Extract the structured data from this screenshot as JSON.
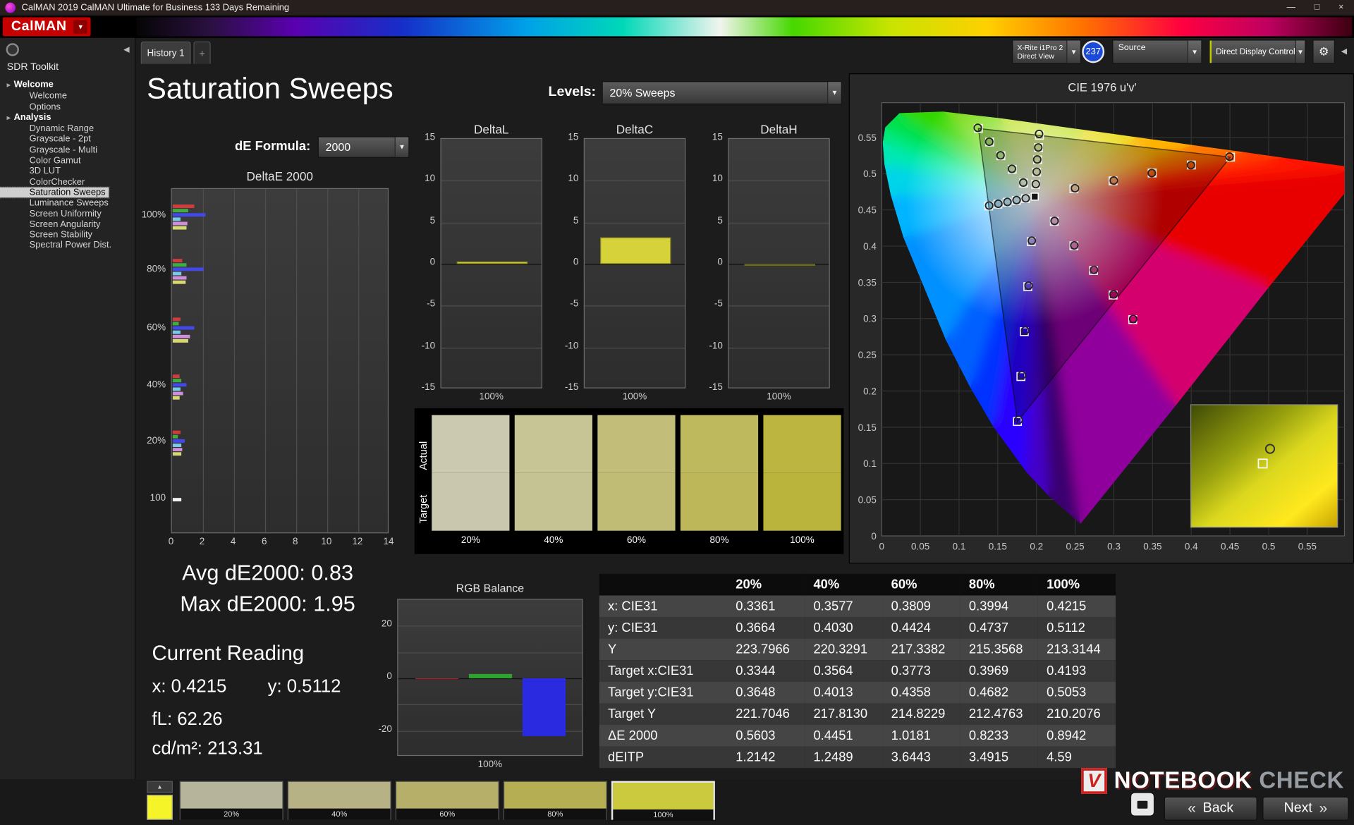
{
  "window": {
    "title": "CalMAN 2019 CalMAN Ultimate for Business 133 Days Remaining",
    "controls": {
      "minimize": "—",
      "maximize": "□",
      "close": "×"
    }
  },
  "icons": {
    "caret_down": "▾",
    "dropdown_arrow": "▼",
    "collapse_left": "◀",
    "up_arrow": "▲",
    "gear": "⚙",
    "tree_expander": "▸",
    "back_chevrons": "«",
    "next_chevrons": "»"
  },
  "logo": {
    "text": "CalMAN"
  },
  "tabs": {
    "history": "History 1",
    "add": "+"
  },
  "toolbar": {
    "meter_line1": "X-Rite i1Pro 2",
    "meter_line2": "Direct View",
    "badge": "237",
    "source": "Source",
    "display_control": "Direct Display Control"
  },
  "sidebar": {
    "title": "SDR Toolkit",
    "selected": "Saturation Sweeps",
    "sections": [
      {
        "label": "Welcome",
        "items": [
          "Welcome",
          "Options"
        ]
      },
      {
        "label": "Analysis",
        "items": [
          "Dynamic Range",
          "Grayscale - 2pt",
          "Grayscale - Multi",
          "Color Gamut",
          "3D LUT",
          "ColorChecker",
          "Saturation Sweeps",
          "Luminance Sweeps",
          "Screen Uniformity",
          "Screen Angularity",
          "Screen Stability",
          "Spectral Power Dist."
        ]
      }
    ]
  },
  "page": {
    "title": "Saturation Sweeps",
    "levels_label": "Levels:",
    "levels_value": "20% Sweeps",
    "de_formula_label": "dE Formula:",
    "de_formula_value": "2000"
  },
  "readings": {
    "avg": "Avg dE2000: 0.83",
    "max": "Max dE2000: 1.95",
    "current_label": "Current Reading",
    "x": "x: 0.4215",
    "y": "y: 0.5112",
    "fl": "fL: 62.26",
    "cdm2": "cd/m²: 213.31"
  },
  "swatch_panel": {
    "actual_label": "Actual",
    "target_label": "Target",
    "levels": [
      {
        "label": "20%",
        "actual": "#cbcab1",
        "target": "#c9c8ae"
      },
      {
        "label": "40%",
        "actual": "#c7c496",
        "target": "#c5c293"
      },
      {
        "label": "60%",
        "actual": "#c2bd79",
        "target": "#c0bc76"
      },
      {
        "label": "80%",
        "actual": "#bfb95e",
        "target": "#bdb75a"
      },
      {
        "label": "100%",
        "actual": "#bcb640",
        "target": "#bab43c"
      }
    ]
  },
  "table": {
    "headers": [
      "20%",
      "40%",
      "60%",
      "80%",
      "100%"
    ],
    "rows": [
      {
        "label": "x: CIE31",
        "values": [
          "0.3361",
          "0.3577",
          "0.3809",
          "0.3994",
          "0.4215"
        ]
      },
      {
        "label": "y: CIE31",
        "values": [
          "0.3664",
          "0.4030",
          "0.4424",
          "0.4737",
          "0.5112"
        ]
      },
      {
        "label": "Y",
        "values": [
          "223.7966",
          "220.3291",
          "217.3382",
          "215.3568",
          "213.3144"
        ]
      },
      {
        "label": "Target x:CIE31",
        "values": [
          "0.3344",
          "0.3564",
          "0.3773",
          "0.3969",
          "0.4193"
        ]
      },
      {
        "label": "Target y:CIE31",
        "values": [
          "0.3648",
          "0.4013",
          "0.4358",
          "0.4682",
          "0.5053"
        ]
      },
      {
        "label": "Target Y",
        "values": [
          "221.7046",
          "217.8130",
          "214.8229",
          "212.4763",
          "210.2076"
        ]
      },
      {
        "label": "ΔE 2000",
        "values": [
          "0.5603",
          "0.4451",
          "1.0181",
          "0.8233",
          "0.8942"
        ]
      },
      {
        "label": "dEITP",
        "values": [
          "1.2142",
          "1.2489",
          "3.6443",
          "3.4915",
          "4.59"
        ]
      }
    ]
  },
  "bottom_bar": {
    "swatches": [
      {
        "label": "20%",
        "color": "#b6b59c",
        "active": false
      },
      {
        "label": "40%",
        "color": "#b6b285",
        "active": false
      },
      {
        "label": "60%",
        "color": "#b5af6a",
        "active": false
      },
      {
        "label": "80%",
        "color": "#b5ae52",
        "active": false
      },
      {
        "label": "100%",
        "color": "#cbc93e",
        "active": true
      }
    ],
    "back": "Back",
    "next": "Next"
  },
  "watermark": {
    "mark": "V",
    "part1": "NOTEBOOK",
    "part2": "CHECK"
  },
  "chart_data": [
    {
      "id": "delta_e",
      "type": "bar",
      "title": "DeltaE 2000",
      "orientation": "horizontal",
      "xlim": [
        0,
        14
      ],
      "x_ticks": [
        0,
        2,
        4,
        6,
        8,
        10,
        12,
        14
      ],
      "series_names": [
        "Red",
        "Green",
        "Blue",
        "Cyan",
        "Magenta",
        "Yellow"
      ],
      "series_colors": [
        "#d03c3c",
        "#3fae3f",
        "#4348e8",
        "#79c9e8",
        "#cf8fd8",
        "#d8d873"
      ],
      "white_color": "#f2f2f2",
      "groups": [
        {
          "label": "100%",
          "values": [
            1.4,
            1.0,
            2.1,
            0.5,
            0.95,
            0.89
          ]
        },
        {
          "label": "80%",
          "values": [
            0.6,
            0.9,
            2.0,
            0.55,
            0.9,
            0.82
          ]
        },
        {
          "label": "60%",
          "values": [
            0.5,
            0.4,
            1.4,
            0.5,
            1.1,
            1.02
          ]
        },
        {
          "label": "40%",
          "values": [
            0.45,
            0.55,
            0.9,
            0.5,
            0.65,
            0.45
          ]
        },
        {
          "label": "20%",
          "values": [
            0.5,
            0.35,
            0.75,
            0.55,
            0.6,
            0.56
          ]
        },
        {
          "label": "100",
          "values": [
            0.55
          ],
          "single": true
        }
      ]
    },
    {
      "id": "delta_l",
      "type": "bar",
      "title": "DeltaL",
      "ylim": [
        -15,
        15
      ],
      "y_ticks": [
        15,
        10,
        5,
        0,
        -5,
        -10,
        -15
      ],
      "categories": [
        "100%"
      ],
      "values": [
        0.3
      ],
      "bar_color": "#d6d23a"
    },
    {
      "id": "delta_c",
      "type": "bar",
      "title": "DeltaC",
      "ylim": [
        -15,
        15
      ],
      "y_ticks": [
        15,
        10,
        5,
        0,
        -5,
        -10,
        -15
      ],
      "categories": [
        "100%"
      ],
      "values": [
        3.2
      ],
      "bar_color": "#d6d23a"
    },
    {
      "id": "delta_h",
      "type": "bar",
      "title": "DeltaH",
      "ylim": [
        -15,
        15
      ],
      "y_ticks": [
        15,
        10,
        5,
        0,
        -5,
        -10,
        -15
      ],
      "categories": [
        "100%"
      ],
      "values": [
        -0.1
      ],
      "bar_color": "#b8b428"
    },
    {
      "id": "rgb_balance",
      "type": "bar",
      "title": "RGB Balance",
      "ylim": [
        -30,
        30
      ],
      "y_ticks": [
        20,
        0,
        -20
      ],
      "categories": [
        "100%"
      ],
      "series": [
        {
          "name": "Red",
          "value": -0.3,
          "color": "#b02020"
        },
        {
          "name": "Green",
          "value": 1.5,
          "color": "#2fa32f"
        },
        {
          "name": "Blue",
          "value": -22,
          "color": "#2a2ae0"
        }
      ]
    },
    {
      "id": "cie",
      "type": "scatter",
      "title": "CIE 1976 u'v'",
      "xlim": [
        0,
        0.598
      ],
      "ylim": [
        0,
        0.598
      ],
      "tick_step": 0.05,
      "tick_labels": [
        "0",
        "0.05",
        "0.1",
        "0.15",
        "0.2",
        "0.25",
        "0.3",
        "0.35",
        "0.4",
        "0.45",
        "0.5",
        "0.55"
      ],
      "white_point": [
        0.1978,
        0.4683
      ],
      "gamut_triangle": {
        "red": [
          0.4507,
          0.5229
        ],
        "green": [
          0.125,
          0.5625
        ],
        "blue": [
          0.1754,
          0.1579
        ]
      },
      "sweeps": [
        {
          "name": "red",
          "targets": [
            [
              0.2484,
              0.4792
            ],
            [
              0.299,
              0.4901
            ],
            [
              0.3495,
              0.501
            ],
            [
              0.4001,
              0.512
            ],
            [
              0.4507,
              0.5229
            ]
          ],
          "measured": [
            [
              0.2498,
              0.4799
            ],
            [
              0.2999,
              0.4905
            ],
            [
              0.349,
              0.5008
            ],
            [
              0.3996,
              0.5117
            ],
            [
              0.4495,
              0.5235
            ]
          ]
        },
        {
          "name": "green",
          "targets": [
            [
              0.1832,
              0.4871
            ],
            [
              0.1687,
              0.506
            ],
            [
              0.1541,
              0.5248
            ],
            [
              0.1396,
              0.5437
            ],
            [
              0.125,
              0.5625
            ]
          ],
          "measured": [
            [
              0.183,
              0.4877
            ],
            [
              0.1683,
              0.5067
            ],
            [
              0.1536,
              0.5253
            ],
            [
              0.139,
              0.5441
            ],
            [
              0.1242,
              0.5633
            ]
          ]
        },
        {
          "name": "blue",
          "targets": [
            [
              0.1933,
              0.4062
            ],
            [
              0.1888,
              0.3441
            ],
            [
              0.1843,
              0.282
            ],
            [
              0.1799,
              0.22
            ],
            [
              0.1754,
              0.1579
            ]
          ],
          "measured": [
            [
              0.194,
              0.4075
            ],
            [
              0.1898,
              0.3455
            ],
            [
              0.1855,
              0.2836
            ],
            [
              0.1812,
              0.2218
            ],
            [
              0.177,
              0.16
            ]
          ]
        },
        {
          "name": "cyan",
          "targets": [
            [
              0.1859,
              0.4657
            ],
            [
              0.174,
              0.4631
            ],
            [
              0.1621,
              0.4606
            ],
            [
              0.1502,
              0.458
            ],
            [
              0.1383,
              0.4554
            ]
          ],
          "measured": [
            [
              0.1861,
              0.466
            ],
            [
              0.1743,
              0.4636
            ],
            [
              0.1625,
              0.461
            ],
            [
              0.1507,
              0.4585
            ],
            [
              0.1389,
              0.456
            ]
          ]
        },
        {
          "name": "magenta",
          "targets": [
            [
              0.2231,
              0.4343
            ],
            [
              0.2484,
              0.4004
            ],
            [
              0.2738,
              0.3664
            ],
            [
              0.2991,
              0.3325
            ],
            [
              0.3244,
              0.2985
            ]
          ],
          "measured": [
            [
              0.2234,
              0.4348
            ],
            [
              0.2489,
              0.401
            ],
            [
              0.2744,
              0.3672
            ],
            [
              0.2997,
              0.3333
            ],
            [
              0.325,
              0.2994
            ]
          ]
        },
        {
          "name": "yellow",
          "targets": [
            [
              0.199,
              0.4852
            ],
            [
              0.2002,
              0.5021
            ],
            [
              0.2015,
              0.5191
            ],
            [
              0.2027,
              0.536
            ],
            [
              0.2039,
              0.5529
            ]
          ],
          "measured": [
            [
              0.1992,
              0.4856
            ],
            [
              0.2003,
              0.5026
            ],
            [
              0.201,
              0.5196
            ],
            [
              0.2024,
              0.5362
            ],
            [
              0.2034,
              0.5549
            ]
          ]
        }
      ],
      "current_marker": [
        0.1978,
        0.4683
      ],
      "inset": {
        "square": [
          0.49,
          0.48
        ],
        "circle": [
          0.54,
          0.36
        ]
      }
    }
  ]
}
